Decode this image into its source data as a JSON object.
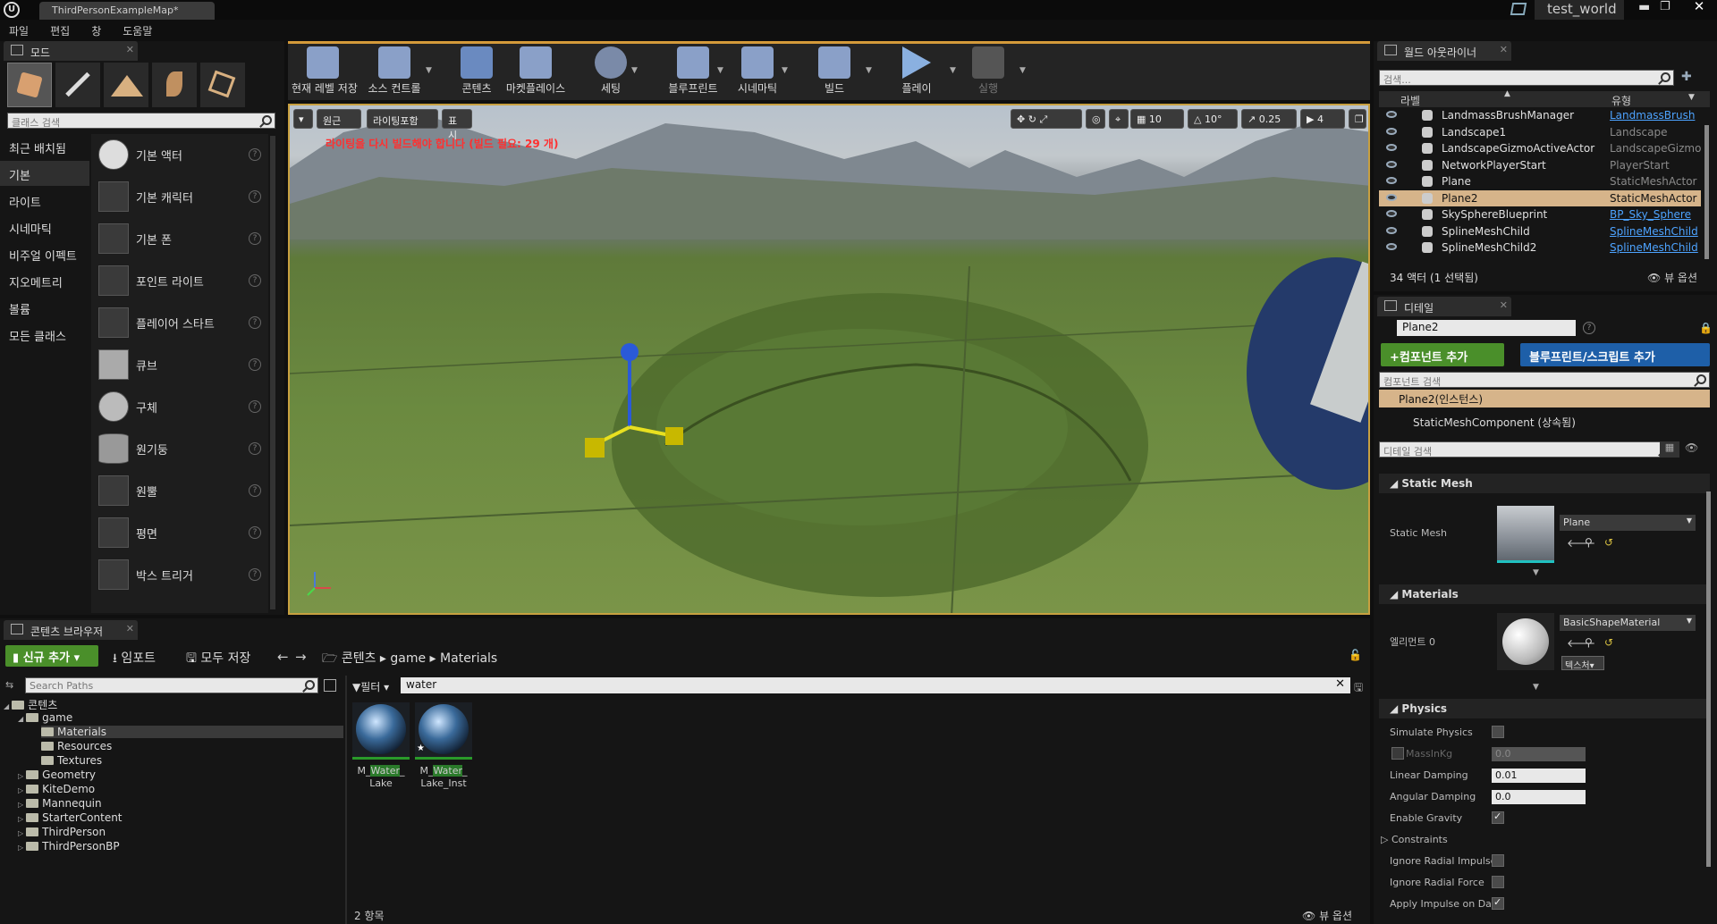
{
  "window": {
    "title": "ThirdPersonExampleMap*",
    "project": "test_world"
  },
  "menu": [
    "파일",
    "편집",
    "창",
    "도움말"
  ],
  "modes": {
    "tab": "모드",
    "search_placeholder": "클래스 검색",
    "categories": [
      "최근 배치됨",
      "기본",
      "라이트",
      "시네마틱",
      "비주얼 이펙트",
      "지오메트리",
      "볼륨",
      "모든 클래스"
    ],
    "items": [
      "기본 액터",
      "기본 캐릭터",
      "기본 폰",
      "포인트 라이트",
      "플레이어 스타트",
      "큐브",
      "구체",
      "원기둥",
      "원뿔",
      "평면",
      "박스 트리거"
    ]
  },
  "toolbar": {
    "buttons": [
      "현재 레벨 저장",
      "소스 컨트롤",
      "콘텐츠",
      "마켓플레이스",
      "세팅",
      "블루프린트",
      "시네마틱",
      "빌드",
      "플레이",
      "실행"
    ]
  },
  "viewport": {
    "perspective": "원근",
    "lit": "라이팅포함",
    "show": "표시",
    "warning": "라이팅을 다시 빌드해야 합니다 (빌드 필요: 29 개)",
    "grid_snap": "10",
    "rot_snap": "10°",
    "scale_snap": "0.25",
    "cam_speed": "4"
  },
  "outliner": {
    "tab": "월드 아웃라이너",
    "search_placeholder": "검색...",
    "col_label": "라벨",
    "col_type": "유형",
    "rows": [
      {
        "name": "LandmassBrushManager",
        "type": "LandmassBrush",
        "link": true
      },
      {
        "name": "Landscape1",
        "type": "Landscape",
        "link": false
      },
      {
        "name": "LandscapeGizmoActiveActor",
        "type": "LandscapeGizmo",
        "link": false
      },
      {
        "name": "NetworkPlayerStart",
        "type": "PlayerStart",
        "link": false
      },
      {
        "name": "Plane",
        "type": "StaticMeshActor",
        "link": false
      },
      {
        "name": "Plane2",
        "type": "StaticMeshActor",
        "link": false,
        "selected": true
      },
      {
        "name": "SkySphereBlueprint",
        "type": "BP_Sky_Sphere",
        "link": true
      },
      {
        "name": "SplineMeshChild",
        "type": "SplineMeshChild",
        "link": true
      },
      {
        "name": "SplineMeshChild2",
        "type": "SplineMeshChild",
        "link": true
      }
    ],
    "status": "34 액터 (1 선택됨)",
    "view_options": "뷰 옵션"
  },
  "details": {
    "tab": "디테일",
    "actor_name": "Plane2",
    "add_component": "+컴포넌트 추가",
    "blueprint_btn": "블루프린트/스크립트 추가",
    "component_search": "컴포넌트 검색",
    "instance": "Plane2(인스턴스)",
    "component": "StaticMeshComponent (상속됨)",
    "detail_search": "디테일 검색",
    "static_mesh_section": "Static Mesh",
    "static_mesh_label": "Static Mesh",
    "static_mesh_value": "Plane",
    "materials_section": "Materials",
    "element_label": "엘리먼트 0",
    "material_value": "BasicShapeMaterial",
    "texture_btn": "텍스처",
    "physics_section": "Physics",
    "props": [
      {
        "label": "Simulate Physics",
        "kind": "check",
        "value": false
      },
      {
        "label": "MassInKg",
        "kind": "numdis",
        "value": "0.0"
      },
      {
        "label": "Linear Damping",
        "kind": "num",
        "value": "0.01"
      },
      {
        "label": "Angular Damping",
        "kind": "num",
        "value": "0.0"
      },
      {
        "label": "Enable Gravity",
        "kind": "check",
        "value": true
      },
      {
        "label": "Constraints",
        "kind": "group",
        "value": ""
      },
      {
        "label": "Ignore Radial Impulse",
        "kind": "check",
        "value": false
      },
      {
        "label": "Ignore Radial Force",
        "kind": "check",
        "value": false
      },
      {
        "label": "Apply Impulse on Dam",
        "kind": "check",
        "value": true
      }
    ]
  },
  "content_browser": {
    "tab": "콘텐츠 브라우저",
    "add_new": "신규 추가",
    "import": "임포트",
    "save_all": "모두 저장",
    "breadcrumb": [
      "콘텐츠",
      "game",
      "Materials"
    ],
    "search_paths": "Search Paths",
    "filter": "필터",
    "filter_text": "water",
    "tree": [
      {
        "label": "콘텐츠",
        "depth": 0
      },
      {
        "label": "game",
        "depth": 1
      },
      {
        "label": "Materials",
        "depth": 2,
        "selected": true
      },
      {
        "label": "Resources",
        "depth": 2
      },
      {
        "label": "Textures",
        "depth": 2
      },
      {
        "label": "Geometry",
        "depth": 1
      },
      {
        "label": "KiteDemo",
        "depth": 1
      },
      {
        "label": "Mannequin",
        "depth": 1
      },
      {
        "label": "StarterContent",
        "depth": 1
      },
      {
        "label": "ThirdPerson",
        "depth": 1
      },
      {
        "label": "ThirdPersonBP",
        "depth": 1
      }
    ],
    "assets": [
      {
        "pre": "M_",
        "hl": "Water",
        "post": "_",
        "line2": "Lake"
      },
      {
        "pre": "M_",
        "hl": "Water",
        "post": "_",
        "line2": "Lake_Inst"
      }
    ],
    "count": "2 항목",
    "view_options": "뷰 옵션"
  },
  "colors": {
    "accent": "#4a8f2a",
    "selection": "#d6b48a",
    "link": "#4da3ff",
    "warning": "#ff3030",
    "blueprint": "#1e5fa8"
  }
}
